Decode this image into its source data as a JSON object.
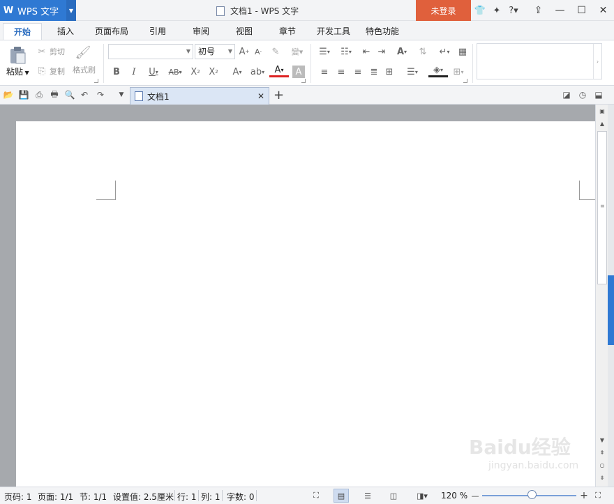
{
  "app": {
    "menu_label": "WPS 文字",
    "window_title": "文档1 - WPS 文字",
    "login_label": "未登录"
  },
  "ribbon_tabs": [
    "开始",
    "插入",
    "页面布局",
    "引用",
    "审阅",
    "视图",
    "章节",
    "开发工具",
    "特色功能"
  ],
  "clipboard": {
    "paste_label": "粘贴",
    "cut_label": "剪切",
    "copy_label": "复制",
    "format_painter_label": "格式刷"
  },
  "font": {
    "font_name_value": "",
    "font_size_value": "初号"
  },
  "document_tab": {
    "name": "文档1"
  },
  "status_bar": {
    "page_code": "页码: 1",
    "page": "页面: 1/1",
    "section": "节: 1/1",
    "setting": "设置值: 2.5厘米",
    "row": "行: 1",
    "column": "列: 1",
    "word_count": "字数: 0",
    "zoom_label": "120 %"
  },
  "watermark": {
    "brand": "Baidu经验",
    "url": "jingyan.baidu.com"
  }
}
